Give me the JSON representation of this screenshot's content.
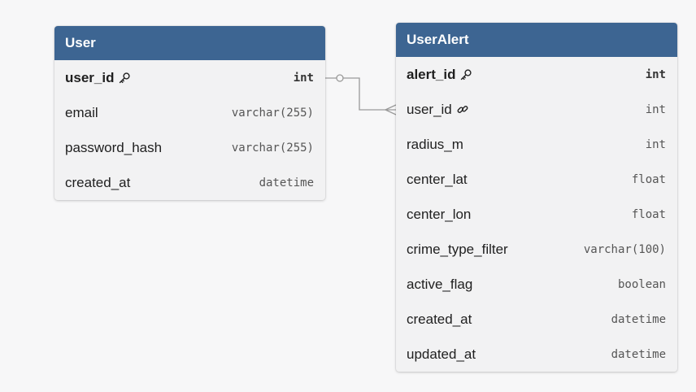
{
  "tables": [
    {
      "name": "User",
      "columns": [
        {
          "name": "user_id",
          "type": "int",
          "pk": true,
          "icon": "key-icon"
        },
        {
          "name": "email",
          "type": "varchar(255)"
        },
        {
          "name": "password_hash",
          "type": "varchar(255)"
        },
        {
          "name": "created_at",
          "type": "datetime"
        }
      ]
    },
    {
      "name": "UserAlert",
      "columns": [
        {
          "name": "alert_id",
          "type": "int",
          "pk": true,
          "icon": "key-icon"
        },
        {
          "name": "user_id",
          "type": "int",
          "icon": "link-icon"
        },
        {
          "name": "radius_m",
          "type": "int"
        },
        {
          "name": "center_lat",
          "type": "float"
        },
        {
          "name": "center_lon",
          "type": "float"
        },
        {
          "name": "crime_type_filter",
          "type": "varchar(100)"
        },
        {
          "name": "active_flag",
          "type": "boolean"
        },
        {
          "name": "created_at",
          "type": "datetime"
        },
        {
          "name": "updated_at",
          "type": "datetime"
        }
      ]
    }
  ],
  "relationship": {
    "from": "User.user_id",
    "to": "UserAlert.user_id",
    "cardinality": "one-to-many"
  },
  "colors": {
    "header": "#3d6592",
    "body": "#f2f2f3",
    "connector": "#9a9a9a"
  }
}
